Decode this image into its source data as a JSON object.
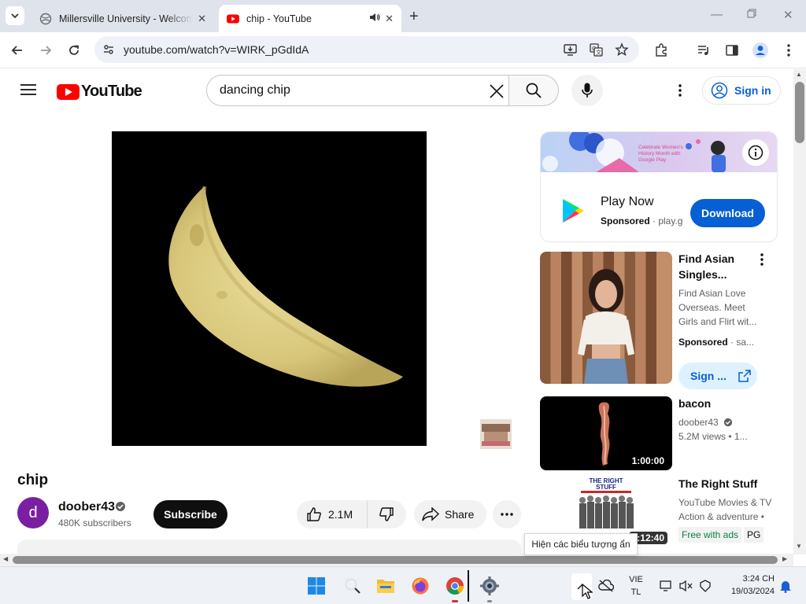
{
  "browser": {
    "tabs": [
      {
        "title": "Millersville University - Welcome",
        "active": false
      },
      {
        "title": "chip - YouTube",
        "active": true
      }
    ],
    "url": "youtube.com/watch?v=WIRK_pGdIdA"
  },
  "youtube": {
    "logo_text": "YouTube",
    "search_query": "dancing chip",
    "signin_label": "Sign in"
  },
  "video": {
    "title": "chip",
    "channel": {
      "avatar_letter": "d",
      "name": "doober43",
      "subscribers": "480K subscribers"
    },
    "subscribe_label": "Subscribe",
    "likes": "2.1M",
    "share_label": "Share"
  },
  "sidebar": {
    "ad": {
      "banner_text": "Celebrate Women's History Month with Google Play",
      "title": "Play Now",
      "sponsored": "Sponsored",
      "domain": "· play.g",
      "cta": "Download"
    },
    "recommendations": [
      {
        "title": "Find Asian Singles...",
        "description": "Find Asian Love Overseas. Meet Girls and Flirt wit...",
        "sponsored": "Sponsored",
        "domain": "· sa...",
        "cta": "Sign ..."
      },
      {
        "title": "bacon",
        "channel": "doober43",
        "meta": "5.2M views  • 1...",
        "duration": "1:00:00"
      },
      {
        "title": "The Right Stuff",
        "channel": "YouTube Movies & TV",
        "meta": "Action & adventure •",
        "duration": "2:12:40",
        "tag_free": "Free with ads",
        "tag_rating": "PG",
        "thumb_text": "THE RIGHT STUFF"
      }
    ]
  },
  "tooltip": "Hiện các biểu tượng ẩn",
  "taskbar": {
    "language": "VIE",
    "layout": "TL",
    "time": "3:24 CH",
    "date": "19/03/2024"
  },
  "colors": {
    "youtube_red": "#ff0000",
    "link_blue": "#065fd4",
    "tab_strip": "#dfe3eb"
  }
}
